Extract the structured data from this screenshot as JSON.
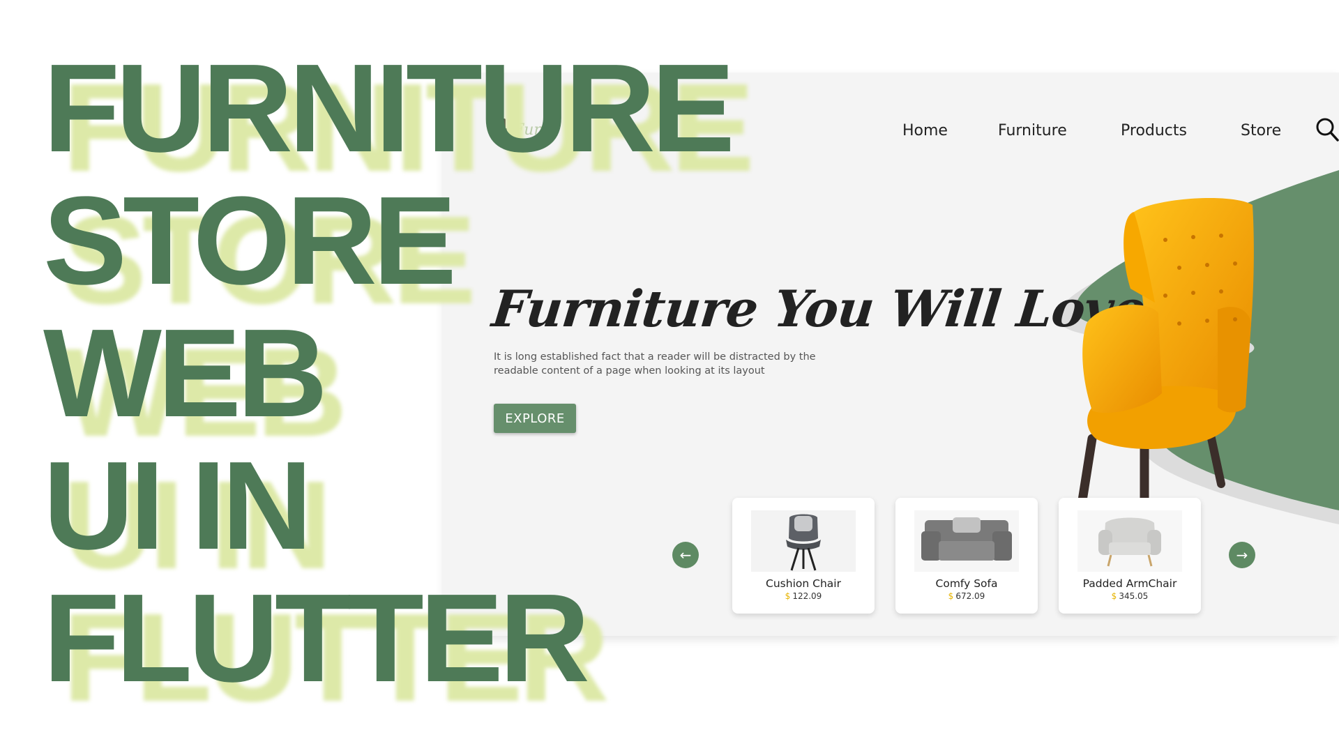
{
  "overlay_title": {
    "lines": [
      "FURNITURE",
      "STORE",
      "WEB",
      "UI IN",
      "FLUTTER"
    ]
  },
  "site": {
    "logo": {
      "icon": "office-chair-icon",
      "text": "Fur"
    },
    "nav": {
      "items": [
        "Home",
        "Furniture",
        "Products",
        "Store"
      ],
      "search_icon": "search-icon"
    },
    "hero": {
      "title": "Furniture You Will Love",
      "description": "It is long established fact that a reader will be distracted by the readable content of a page when looking at its layout",
      "explore_label": "EXPLORE"
    },
    "carousel": {
      "prev_icon": "arrow-left-icon",
      "next_icon": "arrow-right-icon",
      "products": [
        {
          "name": "Cushion Chair",
          "currency": "$",
          "price": "122.09"
        },
        {
          "name": "Comfy Sofa",
          "currency": "$",
          "price": "672.09"
        },
        {
          "name": "Padded ArmChair",
          "currency": "$",
          "price": "345.05"
        }
      ]
    }
  },
  "colors": {
    "brand_green": "#4e7a57",
    "accent_green": "#668f6c",
    "shadow_lime": "#dde9a8",
    "price_currency": "#e7b400",
    "chair_yellow": "#f4a400"
  }
}
